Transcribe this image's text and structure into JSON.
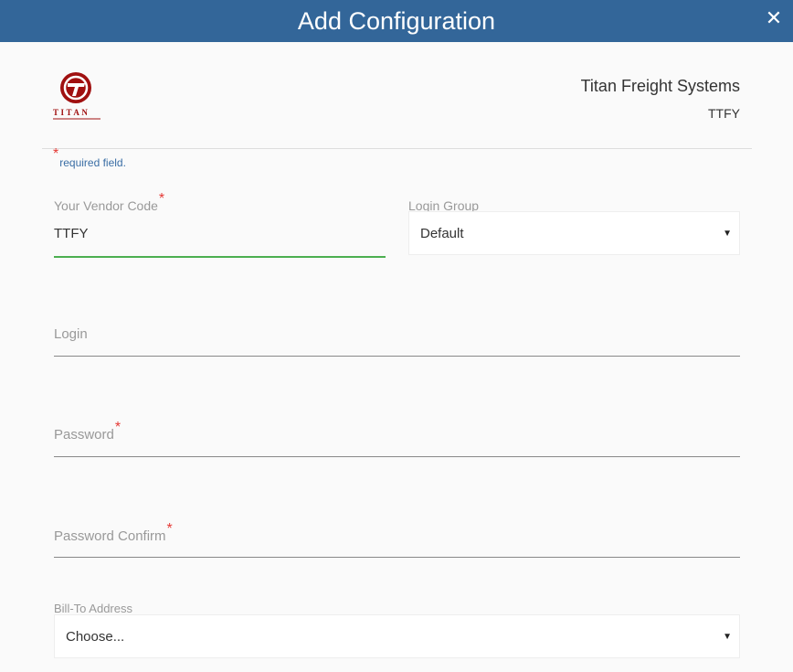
{
  "header": {
    "title": "Add Configuration",
    "close_glyph": "✕"
  },
  "company": {
    "name": "Titan Freight Systems",
    "code": "TTFY",
    "logo_text": "TITAN"
  },
  "form": {
    "required_note": {
      "star": "*",
      "text": "required field."
    },
    "vendor_code": {
      "label": "Your Vendor Code",
      "star": "*",
      "value": "TTFY"
    },
    "login_group": {
      "label": "Login Group",
      "selected": "Default",
      "caret": "▼"
    },
    "login": {
      "label": "Login"
    },
    "password": {
      "label": "Password",
      "star": "*"
    },
    "password_confirm": {
      "label": "Password Confirm",
      "star": "*"
    },
    "bill_to": {
      "label": "Bill-To Address",
      "selected": "Choose...",
      "caret": "▼"
    }
  },
  "colors": {
    "header_bg": "#336699",
    "required": "#e53935",
    "focus": "#4caf50",
    "logo_red": "#a01010"
  }
}
